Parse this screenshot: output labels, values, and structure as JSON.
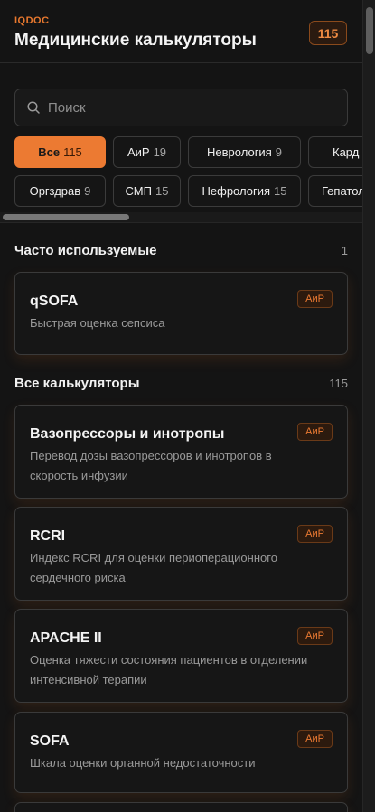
{
  "header": {
    "brand": "IQDOC",
    "title": "Медицинские калькуляторы",
    "total_badge": "115"
  },
  "search": {
    "placeholder": "Поиск"
  },
  "filters": {
    "row1": [
      {
        "label": "Все",
        "count": "115",
        "active": true
      },
      {
        "label": "АиР",
        "count": "19"
      },
      {
        "label": "Неврология",
        "count": "9"
      },
      {
        "label": "Кард",
        "count": ""
      }
    ],
    "row2": [
      {
        "label": "Оргздрав",
        "count": "9"
      },
      {
        "label": "СМП",
        "count": "15"
      },
      {
        "label": "Нефрология",
        "count": "15"
      },
      {
        "label": "Гепатол",
        "count": ""
      }
    ]
  },
  "frequent": {
    "title": "Часто используемые",
    "count": "1",
    "items": [
      {
        "name": "qSOFA",
        "desc": "Быстрая оценка сепсиса",
        "tag": "АиР"
      }
    ]
  },
  "all": {
    "title": "Все калькуляторы",
    "count": "115",
    "items": [
      {
        "name": "Вазопрессоры и инотропы",
        "desc": "Перевод дозы вазопрессоров и инотропов в скорость инфузии",
        "tag": "АиР"
      },
      {
        "name": "RCRI",
        "desc": "Индекс RCRI для оценки периоперационного сердечного риска",
        "tag": "АиР"
      },
      {
        "name": "APACHE II",
        "desc": "Оценка тяжести состояния пациентов в отделении интенсивной терапии",
        "tag": "АиР"
      },
      {
        "name": "SOFA",
        "desc": "Шкала оценки органной недостаточности",
        "tag": "АиР"
      }
    ]
  },
  "colors": {
    "accent": "#ec7a32",
    "background": "#141414",
    "card": "#161616",
    "border": "#3a3a3a"
  },
  "icons": {
    "search": "search-icon"
  }
}
